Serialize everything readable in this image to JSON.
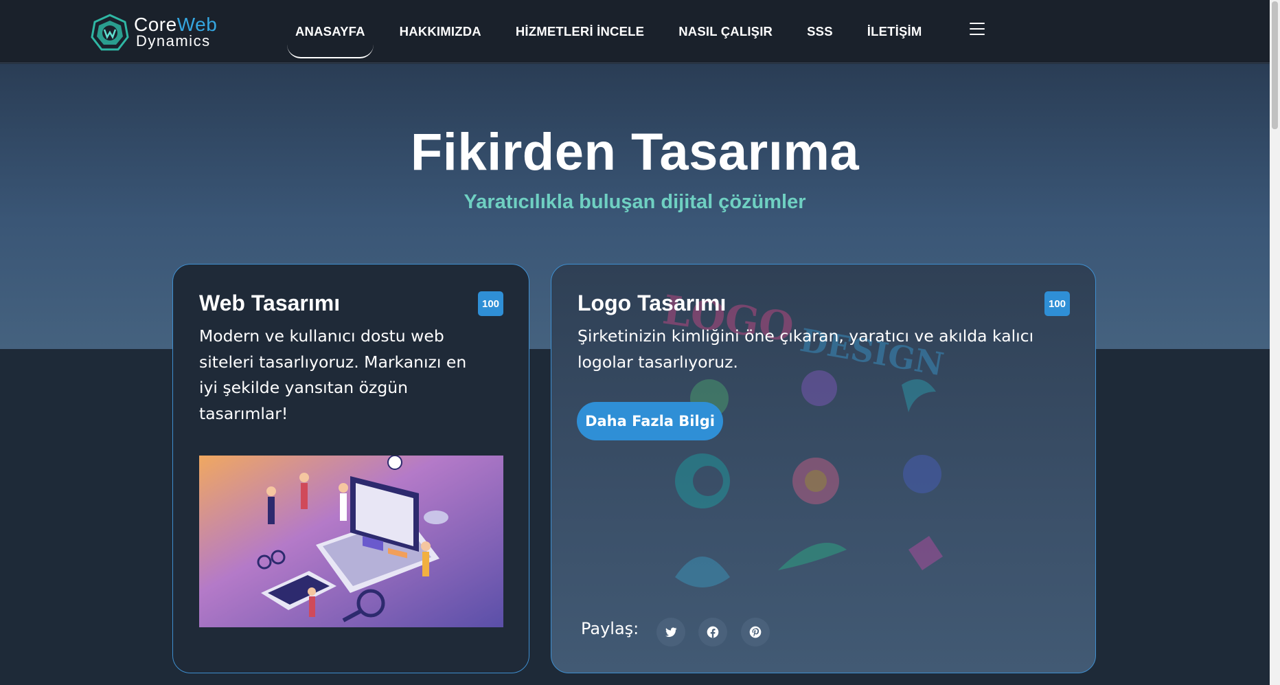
{
  "brand": {
    "name_part1": "Core",
    "name_part2": "Web",
    "name_line2": "Dynamics"
  },
  "nav": {
    "items": [
      {
        "label": "ANASAYFA",
        "active": true
      },
      {
        "label": "HAKKIMIZDA"
      },
      {
        "label": "HİZMETLERİ İNCELE"
      },
      {
        "label": "NASIL ÇALIŞIR"
      },
      {
        "label": "SSS"
      },
      {
        "label": "İLETİŞİM"
      }
    ],
    "menu_icon": "hamburger-icon"
  },
  "hero": {
    "title": "Fikirden Tasarıma",
    "subtitle": "Yaratıcılıkla buluşan dijital çözümler"
  },
  "cards": [
    {
      "title": "Web Tasarımı",
      "badge": "100",
      "text": "Modern ve kullanıcı dostu web siteleri tasarlıyoruz. Markanızı en iyi şekilde yansıtan özgün tasarımlar!",
      "image": "isometric-web-design-illustration"
    },
    {
      "title": "Logo Tasarımı",
      "badge": "100",
      "text": "Şirketinizin kimliğini öne çıkaran, yaratıcı ve akılda kalıcı logolar tasarlıyoruz.",
      "cta": "Daha Fazla Bilgi",
      "share_label": "Paylaş:",
      "share_icons": [
        "twitter-icon",
        "facebook-icon",
        "pinterest-icon"
      ],
      "background_image": "logo-design-collage"
    }
  ],
  "colors": {
    "accent": "#2f8fd6",
    "subtitle": "#6fd0c2",
    "nav_bg": "#1a212b"
  }
}
